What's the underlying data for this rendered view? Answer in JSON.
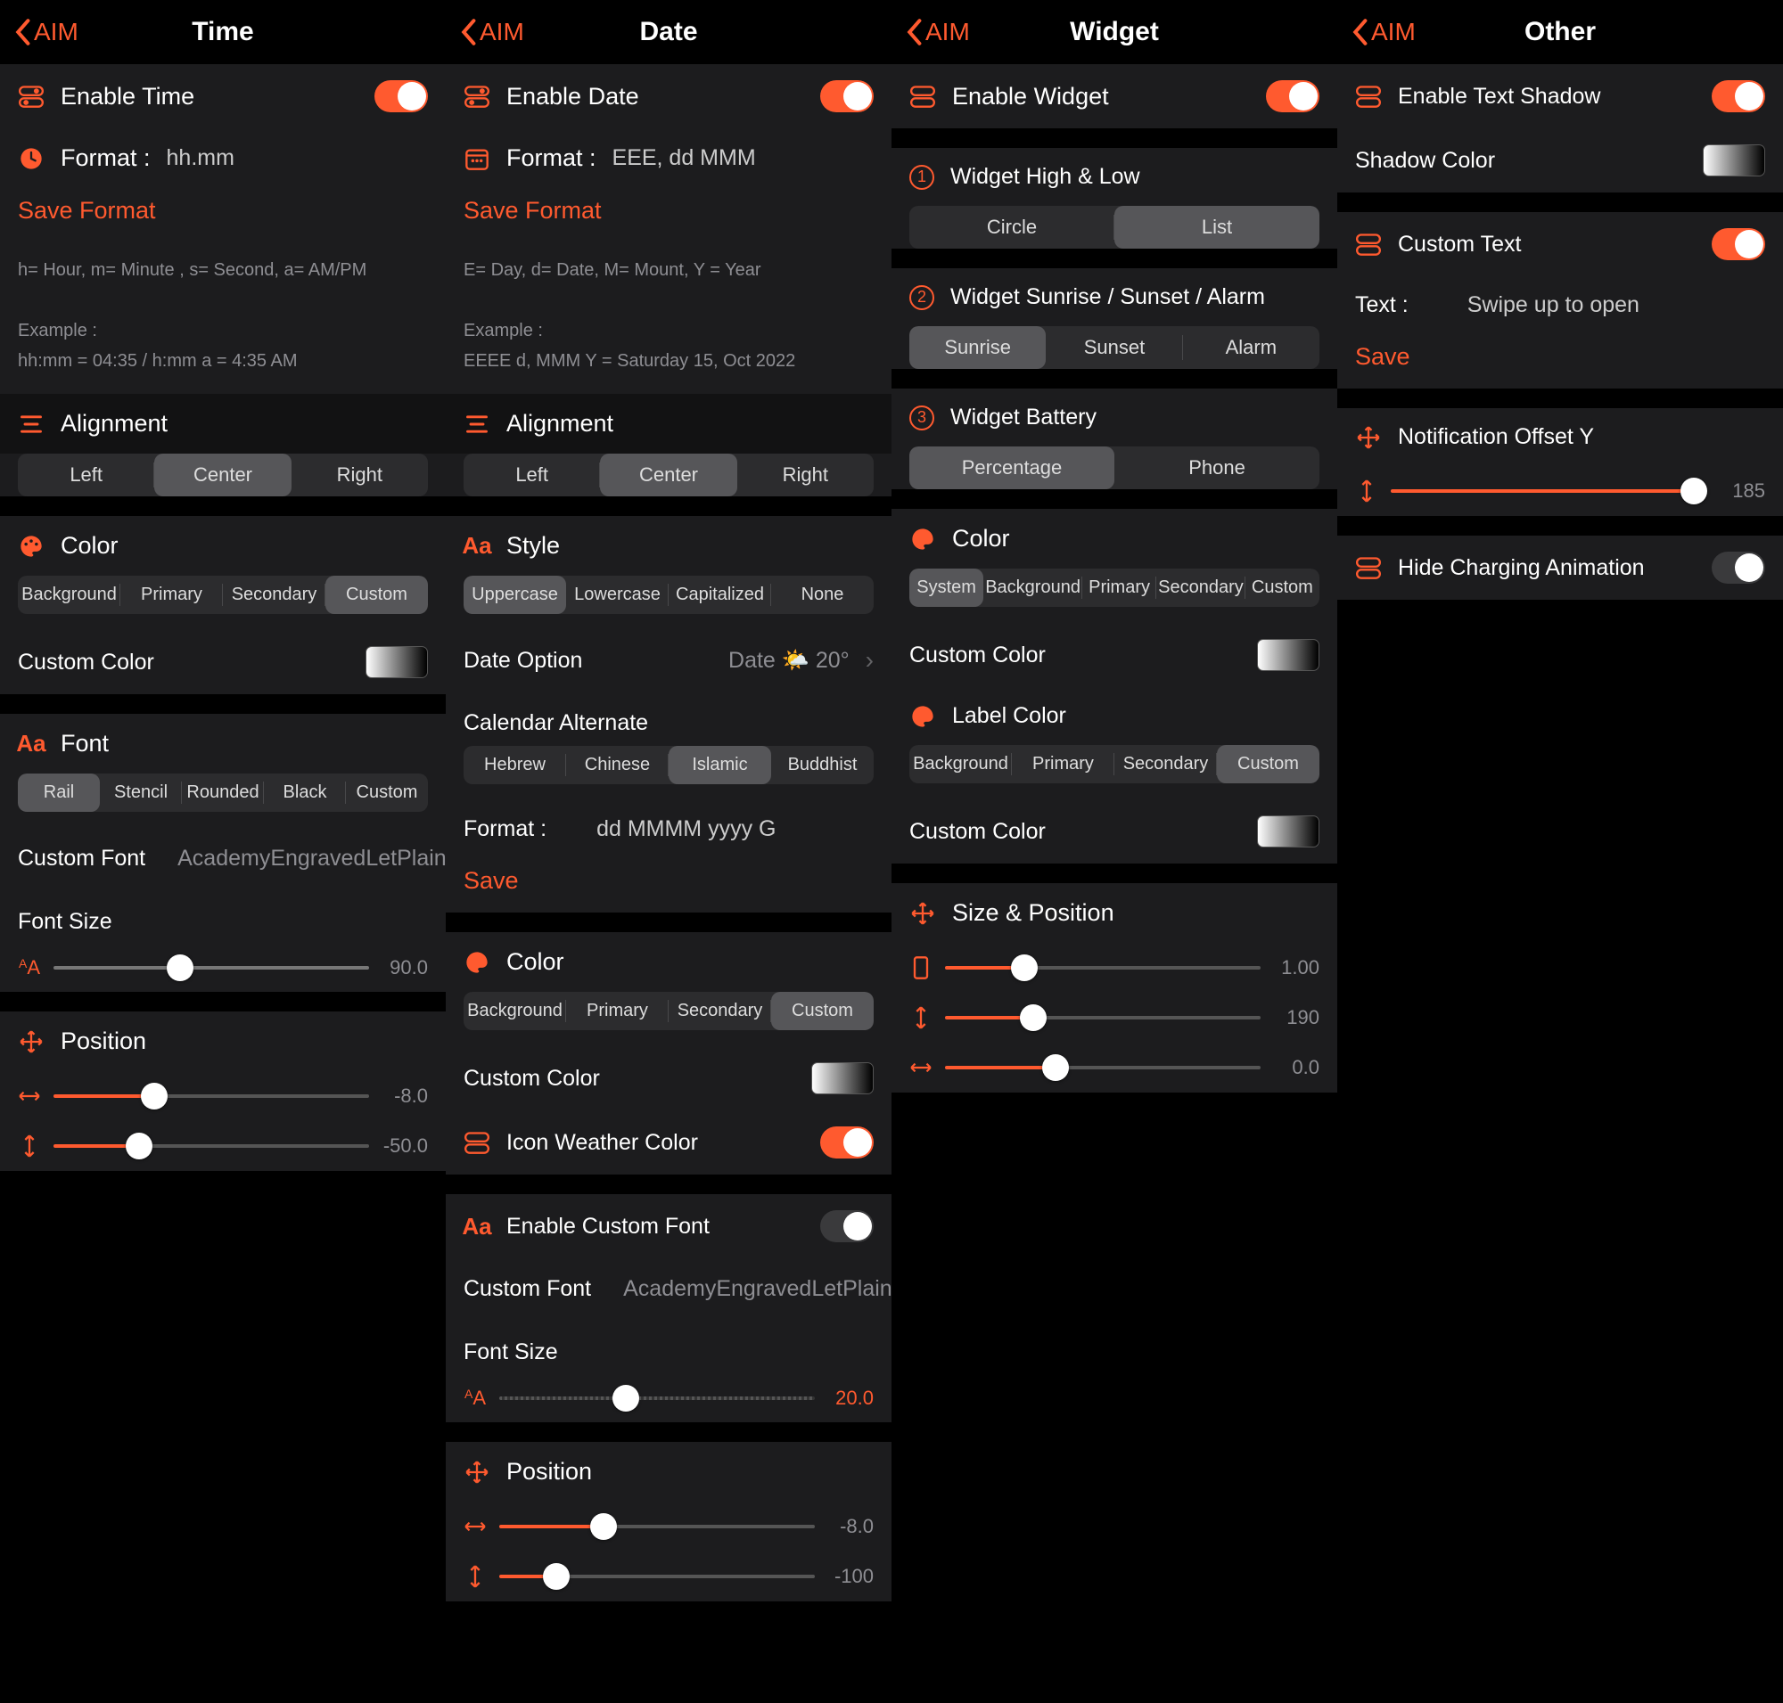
{
  "back_label": "AIM",
  "panels": {
    "time": {
      "title": "Time",
      "enable": "Enable Time",
      "format_label": "Format :",
      "format_value": "hh.mm",
      "save_format": "Save Format",
      "hint1": "h= Hour, m= Minute , s= Second, a= AM/PM",
      "hint2": "Example :",
      "hint3": "hh:mm = 04:35 / h:mm a = 4:35 AM",
      "alignment": "Alignment",
      "align": {
        "left": "Left",
        "center": "Center",
        "right": "Right"
      },
      "color": "Color",
      "color_opts": {
        "bg": "Background",
        "primary": "Primary",
        "secondary": "Secondary",
        "custom": "Custom"
      },
      "custom_color": "Custom Color",
      "font": "Font",
      "font_opts": {
        "rail": "Rail",
        "stencil": "Stencil",
        "rounded": "Rounded",
        "black": "Black",
        "custom": "Custom"
      },
      "custom_font": "Custom Font",
      "custom_font_val": "AcademyEngravedLetPlain",
      "font_size": "Font Size",
      "font_size_val": "90.0",
      "position": "Position",
      "pos_x": "-8.0",
      "pos_y": "-50.0"
    },
    "date": {
      "title": "Date",
      "enable": "Enable Date",
      "format_label": "Format :",
      "format_value": "EEE, dd MMM",
      "save_format": "Save Format",
      "hint1": "E= Day, d= Date, M= Mount, Y = Year",
      "hint2": "Example :",
      "hint3": "EEEE d, MMM Y = Saturday 15, Oct 2022",
      "alignment": "Alignment",
      "align": {
        "left": "Left",
        "center": "Center",
        "right": "Right"
      },
      "style": "Style",
      "style_opts": {
        "upper": "Uppercase",
        "lower": "Lowercase",
        "cap": "Capitalized",
        "none": "None"
      },
      "date_option": "Date Option",
      "date_option_val": "Date 🌤️ 20°",
      "cal_alt": "Calendar Alternate",
      "cal_opts": {
        "hebrew": "Hebrew",
        "chinese": "Chinese",
        "islamic": "Islamic",
        "buddhist": "Buddhist"
      },
      "alt_format_label": "Format :",
      "alt_format_value": "dd MMMM yyyy G",
      "save": "Save",
      "color": "Color",
      "color_opts": {
        "bg": "Background",
        "primary": "Primary",
        "secondary": "Secondary",
        "custom": "Custom"
      },
      "custom_color": "Custom Color",
      "icon_weather": "Icon Weather Color",
      "enable_font": "Enable Custom Font",
      "custom_font": "Custom Font",
      "custom_font_val": "AcademyEngravedLetPlain",
      "font_size": "Font Size",
      "font_size_val": "20.0",
      "position": "Position",
      "pos_x": "-8.0",
      "pos_y": "-100"
    },
    "widget": {
      "title": "Widget",
      "enable": "Enable Widget",
      "w1": "Widget High & Low",
      "w1_opts": {
        "circle": "Circle",
        "list": "List"
      },
      "w2": "Widget Sunrise / Sunset / Alarm",
      "w2_opts": {
        "sunrise": "Sunrise",
        "sunset": "Sunset",
        "alarm": "Alarm"
      },
      "w3": "Widget Battery",
      "w3_opts": {
        "pct": "Percentage",
        "phone": "Phone"
      },
      "color": "Color",
      "color_opts": {
        "system": "System",
        "bg": "Background",
        "primary": "Primary",
        "secondary": "Secondary",
        "custom": "Custom"
      },
      "custom_color": "Custom Color",
      "label_color": "Label Color",
      "label_opts": {
        "bg": "Background",
        "primary": "Primary",
        "secondary": "Secondary",
        "custom": "Custom"
      },
      "size_pos": "Size & Position",
      "scale_val": "1.00",
      "pos_y_val": "190",
      "pos_x_val": "0.0"
    },
    "other": {
      "title": "Other",
      "shadow": "Enable Text Shadow",
      "shadow_color": "Shadow Color",
      "custom_text": "Custom Text",
      "text_label": "Text :",
      "text_val": "Swipe up to open",
      "save": "Save",
      "notif_offset": "Notification Offset Y",
      "notif_val": "185",
      "hide_charging": "Hide Charging Animation"
    }
  }
}
